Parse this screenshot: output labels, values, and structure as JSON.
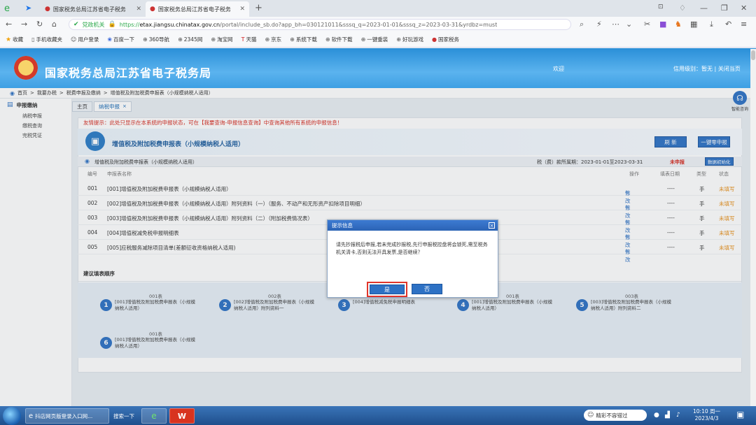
{
  "browser": {
    "tabs": [
      {
        "title": "国家税务总局江苏省电子税务"
      },
      {
        "title": "国家税务总局江苏省电子税务"
      }
    ],
    "security_label": "党政机关",
    "url_prefix": "https://",
    "url_host": "etax.jiangsu.chinatax.gov.cn",
    "url_path": "/portal/include_sb.do?app_bh=030121011&sssq_q=2023-01-01&sssq_z=2023-03-31&yrdbz=must",
    "bookmarks": [
      "收藏",
      "手机收藏夹",
      "用户登录",
      "百度一下",
      "360导航",
      "2345网",
      "淘宝网",
      "天猫",
      "京东",
      "系统下载",
      "软件下载",
      "一键重装",
      "好玩游戏",
      "国家税务"
    ]
  },
  "site": {
    "title": "国家税务总局江苏省电子税务局",
    "welcome": "欢迎",
    "user_info": "信用级别：暂无 | 关闭当页"
  },
  "crumbs": [
    "首页",
    "我要办税",
    "税费申报及缴纳",
    "增值税及附加税费申报表（小规模纳税人适用）"
  ],
  "nav_tabs": {
    "home": "主页",
    "current": "纳税申报"
  },
  "sidebar": {
    "title": "申报缴纳",
    "items": [
      "纳税申报",
      "缴税查询",
      "完税凭证"
    ]
  },
  "help_label": "智能咨询",
  "tip": "友情提示：此处只显示在本系统的申报状态，可在【我要查询-申报信息查询】中查询其他所有系统的申报信息！",
  "form": {
    "title": "增值税及附加税费申报表（小规模纳税人适用）",
    "refresh_label": "刷 新",
    "zero_label": "一键零申报",
    "table_title": "增值税及附加税费申报表（小规模纳税人适用）",
    "period_text": "税（费）款所属期：2023-01-01至2023-03-31",
    "status": "未申报",
    "init_label": "数据初始化",
    "columns": {
      "no": "编号",
      "name": "申报表名称",
      "op": "操作",
      "date": "填表日期",
      "type": "类型",
      "state": "状态"
    },
    "rows": [
      {
        "no": "001",
        "name": "[001]增值税及附加税费申报表（小规模纳税人适用）",
        "op": "修改",
        "date": "----",
        "type": "手",
        "state": "未填写"
      },
      {
        "no": "002",
        "name": "[002]增值税及附加税费申报表（小规模纳税人适用）附列资料（一）（服务、不动产和无形资产扣除项目明细）",
        "op": "修改",
        "date": "----",
        "type": "手",
        "state": "未填写"
      },
      {
        "no": "003",
        "name": "[003]增值税及附加税费申报表（小规模纳税人适用）附列资料（二）（附加税费情况表）",
        "op": "修改",
        "date": "----",
        "type": "手",
        "state": "未填写"
      },
      {
        "no": "004",
        "name": "[004]增值税减免税申报明细表",
        "op": "修改",
        "date": "----",
        "type": "手",
        "state": "未填写"
      },
      {
        "no": "005",
        "name": "[005]应税服务减除项目清单(差额征收资格纳税人适用)",
        "op": "修改",
        "date": "----",
        "type": "手",
        "state": "未填写"
      }
    ]
  },
  "sequence": {
    "title": "建议填表顺序",
    "steps": [
      {
        "num": "1",
        "label": "001表",
        "text": "[001]增值税及附加税费申报表（小规模纳税人适用）"
      },
      {
        "num": "2",
        "label": "002表",
        "text": "[002]增值税及附加税费申报表（小规模纳税人适用）附列资料一"
      },
      {
        "num": "3",
        "label": "",
        "text": "[004]增值税减免税申报明细表"
      },
      {
        "num": "4",
        "label": "001表",
        "text": "[001]增值税及附加税费申报表（小规模纳税人适用）"
      },
      {
        "num": "5",
        "label": "003表",
        "text": "[003]增值税及附加税费申报表（小规模纳税人适用）附列资料二"
      },
      {
        "num": "6",
        "label": "001表",
        "text": "[001]增值税及附加税费申报表（小规模纳税人适用）"
      }
    ]
  },
  "dialog": {
    "title": "提示信息",
    "message": "请先抄报税后申报,若未完成抄报税,先行申报税控盘将会锁死,需至税务机关清卡,否则无法开具发票,是否继续？",
    "yes": "是",
    "no": "否"
  },
  "taskbar": {
    "item1": "抖店网页版登录入口网...",
    "search": "搜索一下",
    "news": "精彩不容错过",
    "time": "10:10 周一",
    "date": "2023/4/3"
  },
  "colors": {
    "accent": "#2d71c4",
    "warn": "#d6281d",
    "header": "#3e9fe3"
  }
}
